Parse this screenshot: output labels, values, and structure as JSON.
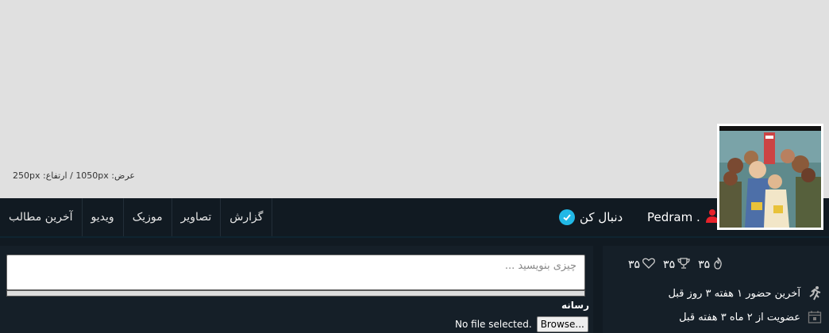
{
  "cover": {
    "size_text": "عرض: 1050px / ارتفاع: 250px"
  },
  "profile": {
    "username": "Pedram .",
    "follow_label": "دنبال کن"
  },
  "tabs": [
    {
      "label": "گزارش"
    },
    {
      "label": "تصاویر"
    },
    {
      "label": "موزیک"
    },
    {
      "label": "ویدیو"
    },
    {
      "label": "آخرین مطالب"
    }
  ],
  "stats": {
    "points": "۳۵",
    "trophies": "۳۵",
    "likes": "۳۵"
  },
  "info": {
    "last_seen": "آخرین حضور ۱ هفته ۳ روز قبل",
    "member_since": "عضویت از ۲ ماه ۳ هفته قبل"
  },
  "compose": {
    "placeholder": "چیزی بنویسید ...",
    "media_label": "رسانه",
    "browse_label": "Browse...",
    "file_status": "No file selected."
  },
  "colors": {
    "accent": "#21b8e6",
    "user_icon": "#e8232b",
    "bg": "#111a22"
  }
}
